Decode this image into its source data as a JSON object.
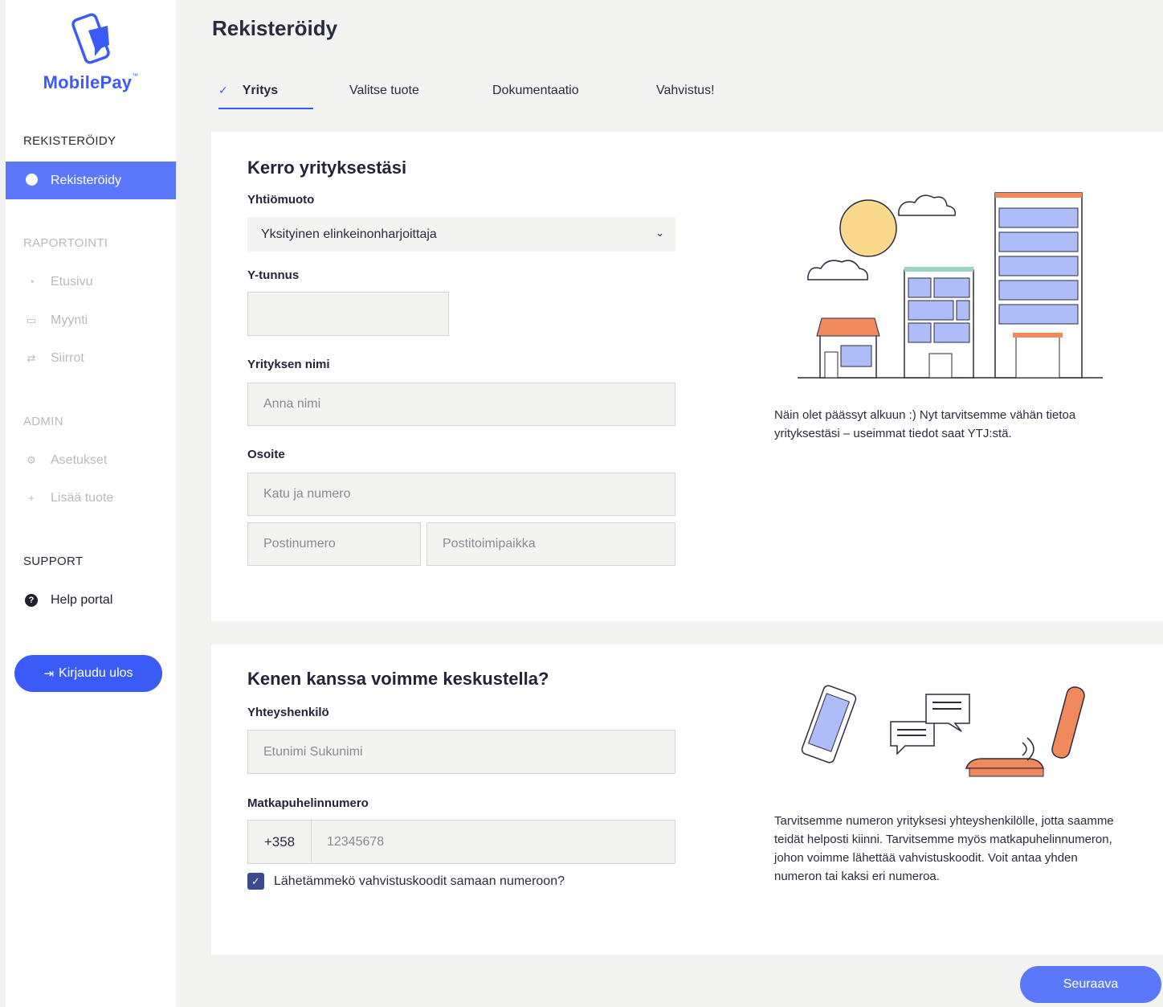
{
  "brand": {
    "name": "MobilePay",
    "trademark": "™"
  },
  "sidebar": {
    "sections": {
      "register": "REKISTERÖIDY",
      "reporting": "RAPORTOINTI",
      "admin": "ADMIN",
      "support": "SUPPORT"
    },
    "items": {
      "register": "Rekisteröidy",
      "home": "Etusivu",
      "sales": "Myynti",
      "transfers": "Siirrot",
      "settings": "Asetukset",
      "add_product": "Lisää tuote",
      "help": "Help portal"
    },
    "logout_label": "Kirjaudu ulos"
  },
  "header": {
    "title": "Rekisteröidy",
    "tabs": [
      "Yritys",
      "Valitse tuote",
      "Dokumentaatio",
      "Vahvistus!"
    ],
    "active_tab": "Yritys"
  },
  "company_card": {
    "title": "Kerro yrityksestäsi",
    "company_type_label": "Yhtiömuoto",
    "company_type_value": "Yksityinen elinkeinonharjoittaja",
    "business_id_label": "Y-tunnus",
    "business_id_value": "",
    "company_name_label": "Yrityksen nimi",
    "company_name_placeholder": "Anna nimi",
    "address_label": "Osoite",
    "street_placeholder": "Katu ja numero",
    "postal_code_placeholder": "Postinumero",
    "city_placeholder": "Postitoimipaikka",
    "info_text": "Näin olet päässyt alkuun :) Nyt tarvitsemme vähän tietoa yrityksestäsi – useimmat tiedot saat YTJ:stä."
  },
  "contact_card": {
    "title": "Kenen kanssa voimme keskustella?",
    "contact_label": "Yhteyshenkilö",
    "contact_placeholder": "Etunimi Sukunimi",
    "phone_label": "Matkapuhelinnumero",
    "phone_prefix": "+358",
    "phone_placeholder": "12345678",
    "same_number_label": "Lähetämmekö vahvistuskoodit samaan numeroon?",
    "same_number_checked": true,
    "info_text": "Tarvitsemme numeron yrityksesi yhteyshenkilölle, jotta saamme teidät helposti kiinni. Tarvitsemme myös matkapuhelinnumeron, johon voimme lähettää vahvistuskoodit. Voit antaa yhden numeron tai kaksi eri numeroa."
  },
  "footer": {
    "next_label": "Seuraava"
  },
  "colors": {
    "brand_blue": "#3b5bf6",
    "active_blue": "#5a78f9",
    "muted": "#b9b9c2"
  }
}
